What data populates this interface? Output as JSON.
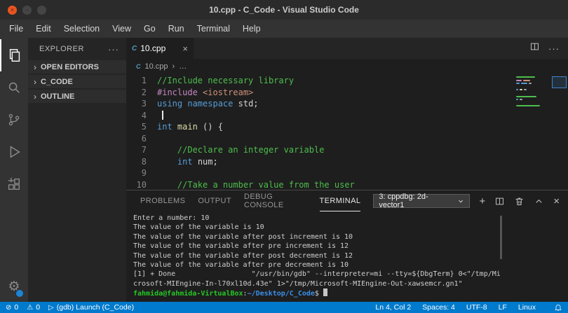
{
  "colors": {
    "accent": "#007acc",
    "close_button": "#e95420",
    "comment": "#4dbd4d",
    "keyword": "#569cd6",
    "directive": "#c586c0",
    "string": "#ce9178",
    "function": "#dcdcaa",
    "terminal_user": "#26c626",
    "terminal_path": "#3b8eea"
  },
  "window": {
    "title": "10.cpp - C_Code - Visual Studio Code"
  },
  "menu": {
    "items": [
      "File",
      "Edit",
      "Selection",
      "View",
      "Go",
      "Run",
      "Terminal",
      "Help"
    ]
  },
  "activity_bar": {
    "items": [
      {
        "id": "explorer",
        "active": true
      },
      {
        "id": "search",
        "active": false
      },
      {
        "id": "source-control",
        "active": false
      },
      {
        "id": "run-debug",
        "active": false
      },
      {
        "id": "extensions",
        "active": false
      }
    ],
    "bottom": {
      "id": "settings-gear",
      "badge": true
    }
  },
  "sidebar": {
    "title": "EXPLORER",
    "sections": [
      {
        "label": "OPEN EDITORS"
      },
      {
        "label": "C_CODE"
      },
      {
        "label": "OUTLINE"
      }
    ]
  },
  "editor": {
    "tab": {
      "label": "10.cpp"
    },
    "breadcrumb": {
      "file": "10.cpp",
      "more": "…"
    },
    "lines": [
      {
        "num": "1",
        "tokens": [
          {
            "t": "//Include necessary library",
            "c": "comment"
          }
        ]
      },
      {
        "num": "2",
        "tokens": [
          {
            "t": "#include ",
            "c": "directive"
          },
          {
            "t": "<iostream>",
            "c": "string"
          }
        ]
      },
      {
        "num": "3",
        "tokens": [
          {
            "t": "using",
            "c": "keyword"
          },
          {
            "t": " ",
            "c": "plain"
          },
          {
            "t": "namespace",
            "c": "keyword"
          },
          {
            "t": " std;",
            "c": "plain"
          }
        ]
      },
      {
        "num": "4",
        "tokens": [
          {
            "t": " ",
            "c": "plain"
          }
        ],
        "cursor": true
      },
      {
        "num": "5",
        "tokens": [
          {
            "t": "int",
            "c": "keyword"
          },
          {
            "t": " ",
            "c": "plain"
          },
          {
            "t": "main",
            "c": "func"
          },
          {
            "t": " () {",
            "c": "plain"
          }
        ]
      },
      {
        "num": "6",
        "tokens": []
      },
      {
        "num": "7",
        "tokens": [
          {
            "t": "    //Declare an integer variable",
            "c": "comment"
          }
        ]
      },
      {
        "num": "8",
        "tokens": [
          {
            "t": "    ",
            "c": "plain"
          },
          {
            "t": "int",
            "c": "keyword"
          },
          {
            "t": " num;",
            "c": "plain"
          }
        ]
      },
      {
        "num": "9",
        "tokens": []
      },
      {
        "num": "10",
        "tokens": [
          {
            "t": "    //Take a number value from the user",
            "c": "comment"
          }
        ]
      }
    ]
  },
  "panel": {
    "tabs": [
      {
        "label": "PROBLEMS",
        "active": false
      },
      {
        "label": "OUTPUT",
        "active": false
      },
      {
        "label": "DEBUG CONSOLE",
        "active": false
      },
      {
        "label": "TERMINAL",
        "active": true
      }
    ],
    "dropdown": {
      "value": "3: cppdbg: 2d-vector1"
    },
    "terminal_lines": [
      {
        "tokens": [
          {
            "t": "Enter a number: 10",
            "c": "plain"
          }
        ]
      },
      {
        "tokens": [
          {
            "t": "The value of the variable is 10",
            "c": "plain"
          }
        ]
      },
      {
        "tokens": [
          {
            "t": "The value of the variable after post increment is 10",
            "c": "plain"
          }
        ]
      },
      {
        "tokens": [
          {
            "t": "The value of the variable after pre increment is 12",
            "c": "plain"
          }
        ]
      },
      {
        "tokens": [
          {
            "t": "The value of the variable after post decrement is 12",
            "c": "plain"
          }
        ]
      },
      {
        "tokens": [
          {
            "t": "The value of the variable after pre decrement is 10",
            "c": "plain"
          }
        ]
      },
      {
        "tokens": [
          {
            "t": "[1] + Done                  \"/usr/bin/gdb\" --interpreter=mi --tty=${DbgTerm} 0<\"/tmp/Mi",
            "c": "plain"
          }
        ]
      },
      {
        "tokens": [
          {
            "t": "crosoft-MIEngine-In-l70xl10d.43e\" 1>\"/tmp/Microsoft-MIEngine-Out-xawsemcr.gn1\"",
            "c": "plain"
          }
        ]
      },
      {
        "tokens": [
          {
            "t": "fahmida@fahmida-VirtualBox",
            "c": "green"
          },
          {
            "t": ":",
            "c": "plain"
          },
          {
            "t": "~/Desktop/C_Code",
            "c": "blue"
          },
          {
            "t": "$ ",
            "c": "plain"
          }
        ],
        "cursor": true
      }
    ]
  },
  "status_bar": {
    "left": [
      {
        "icon": "error",
        "label": "0"
      },
      {
        "icon": "warning",
        "label": "0"
      },
      {
        "icon": "debug",
        "label": "(gdb) Launch (C_Code)"
      }
    ],
    "right": [
      "Ln 4, Col 2",
      "Spaces: 4",
      "UTF-8",
      "LF",
      "Linux"
    ]
  }
}
